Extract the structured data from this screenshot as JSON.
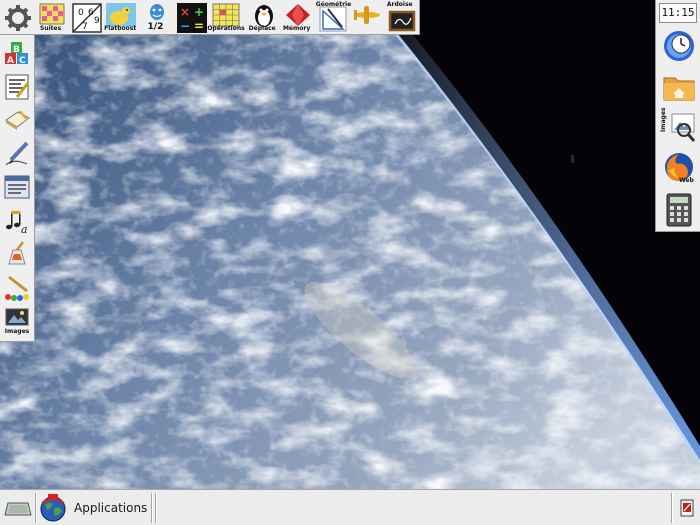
{
  "clock": {
    "time": "11:15"
  },
  "top_launcher": [
    {
      "icon": "gear-icon",
      "label": ""
    },
    {
      "icon": "grid-suites-icon",
      "label": "Suites"
    },
    {
      "icon": "numbers-icon",
      "label": ""
    },
    {
      "icon": "flatboost-icon",
      "label": "Flatboost"
    },
    {
      "icon": "counting-icon",
      "label": "1/2"
    },
    {
      "icon": "math-operations-icon",
      "label": ""
    },
    {
      "icon": "operations-grid-icon",
      "label": "Opérations"
    },
    {
      "icon": "penguin-icon",
      "label": "Déplace"
    },
    {
      "icon": "gem-icon",
      "label": "Mémory"
    },
    {
      "icon": "geometry-icon",
      "label": "Géométrie"
    },
    {
      "icon": "airplane-icon",
      "label": ""
    },
    {
      "icon": "slate-icon",
      "label": "Ardoise"
    }
  ],
  "left_launcher": [
    {
      "icon": "alphabet-blocks-icon",
      "label": ""
    },
    {
      "icon": "text-editor-icon",
      "label": ""
    },
    {
      "icon": "notebook-icon",
      "label": ""
    },
    {
      "icon": "drawing-pen-icon",
      "label": ""
    },
    {
      "icon": "document-icon",
      "label": ""
    },
    {
      "icon": "music-letters-icon",
      "label": ""
    },
    {
      "icon": "paint-icon",
      "label": ""
    },
    {
      "icon": "paint-palette-icon",
      "label": ""
    },
    {
      "icon": "images-viewer-icon",
      "label": "Images"
    }
  ],
  "right_launcher": [
    {
      "icon": "clock-globe-icon",
      "label": ""
    },
    {
      "icon": "home-folder-icon",
      "label": ""
    },
    {
      "icon": "images-folder-icon",
      "label": "Images"
    },
    {
      "icon": "firefox-icon",
      "label": "Web"
    },
    {
      "icon": "calculator-icon",
      "label": ""
    }
  ],
  "bottom_panel": {
    "applications_label": "Applications",
    "show_desktop_icon": "show-desktop-icon",
    "apps_menu_icon": "globe-menu-icon",
    "tray_icon": "tray-application-icon"
  },
  "colors": {
    "panel": "#efefef",
    "space": "#050508",
    "atmosphere": "#5f8fd6"
  }
}
